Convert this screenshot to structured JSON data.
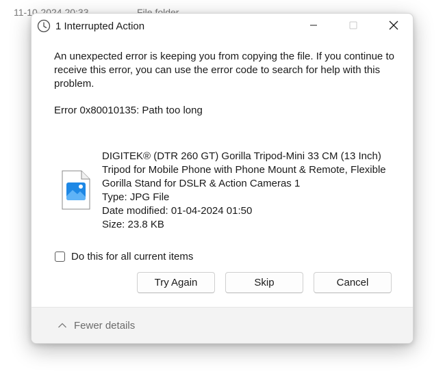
{
  "background": {
    "date_text": "11-10-2024 20:33",
    "type_text": "File folder"
  },
  "dialog": {
    "title": "1 Interrupted Action",
    "message": "An unexpected error is keeping you from copying the file. If you continue to receive this error, you can use the error code to search for help with this problem.",
    "error_code": "Error 0x80010135: Path too long",
    "file": {
      "name_line1": "DIGITEK® (DTR 260 GT) Gorilla Tripod-Mini 33 CM (13 Inch)",
      "name_line2": "Tripod for Mobile Phone with Phone Mount & Remote, Flexible",
      "name_line3": "Gorilla Stand for DSLR & Action Cameras 1",
      "type": "Type: JPG File",
      "date_modified": "Date modified: 01-04-2024 01:50",
      "size": "Size: 23.8 KB"
    },
    "checkbox_label": "Do this for all current items",
    "checkbox_checked": false,
    "buttons": {
      "try_again": "Try Again",
      "skip": "Skip",
      "cancel": "Cancel"
    },
    "footer": {
      "fewer_details": "Fewer details"
    }
  },
  "icons": {
    "title": "clock-icon",
    "file": "image-file-icon",
    "minimize": "minimize-icon",
    "maximize": "maximize-icon",
    "close": "close-icon",
    "chevron": "chevron-up-icon"
  },
  "colors": {
    "accent": "#1e88e5",
    "footer_bg": "#f3f3f3",
    "muted_text": "#6b6b6b"
  }
}
